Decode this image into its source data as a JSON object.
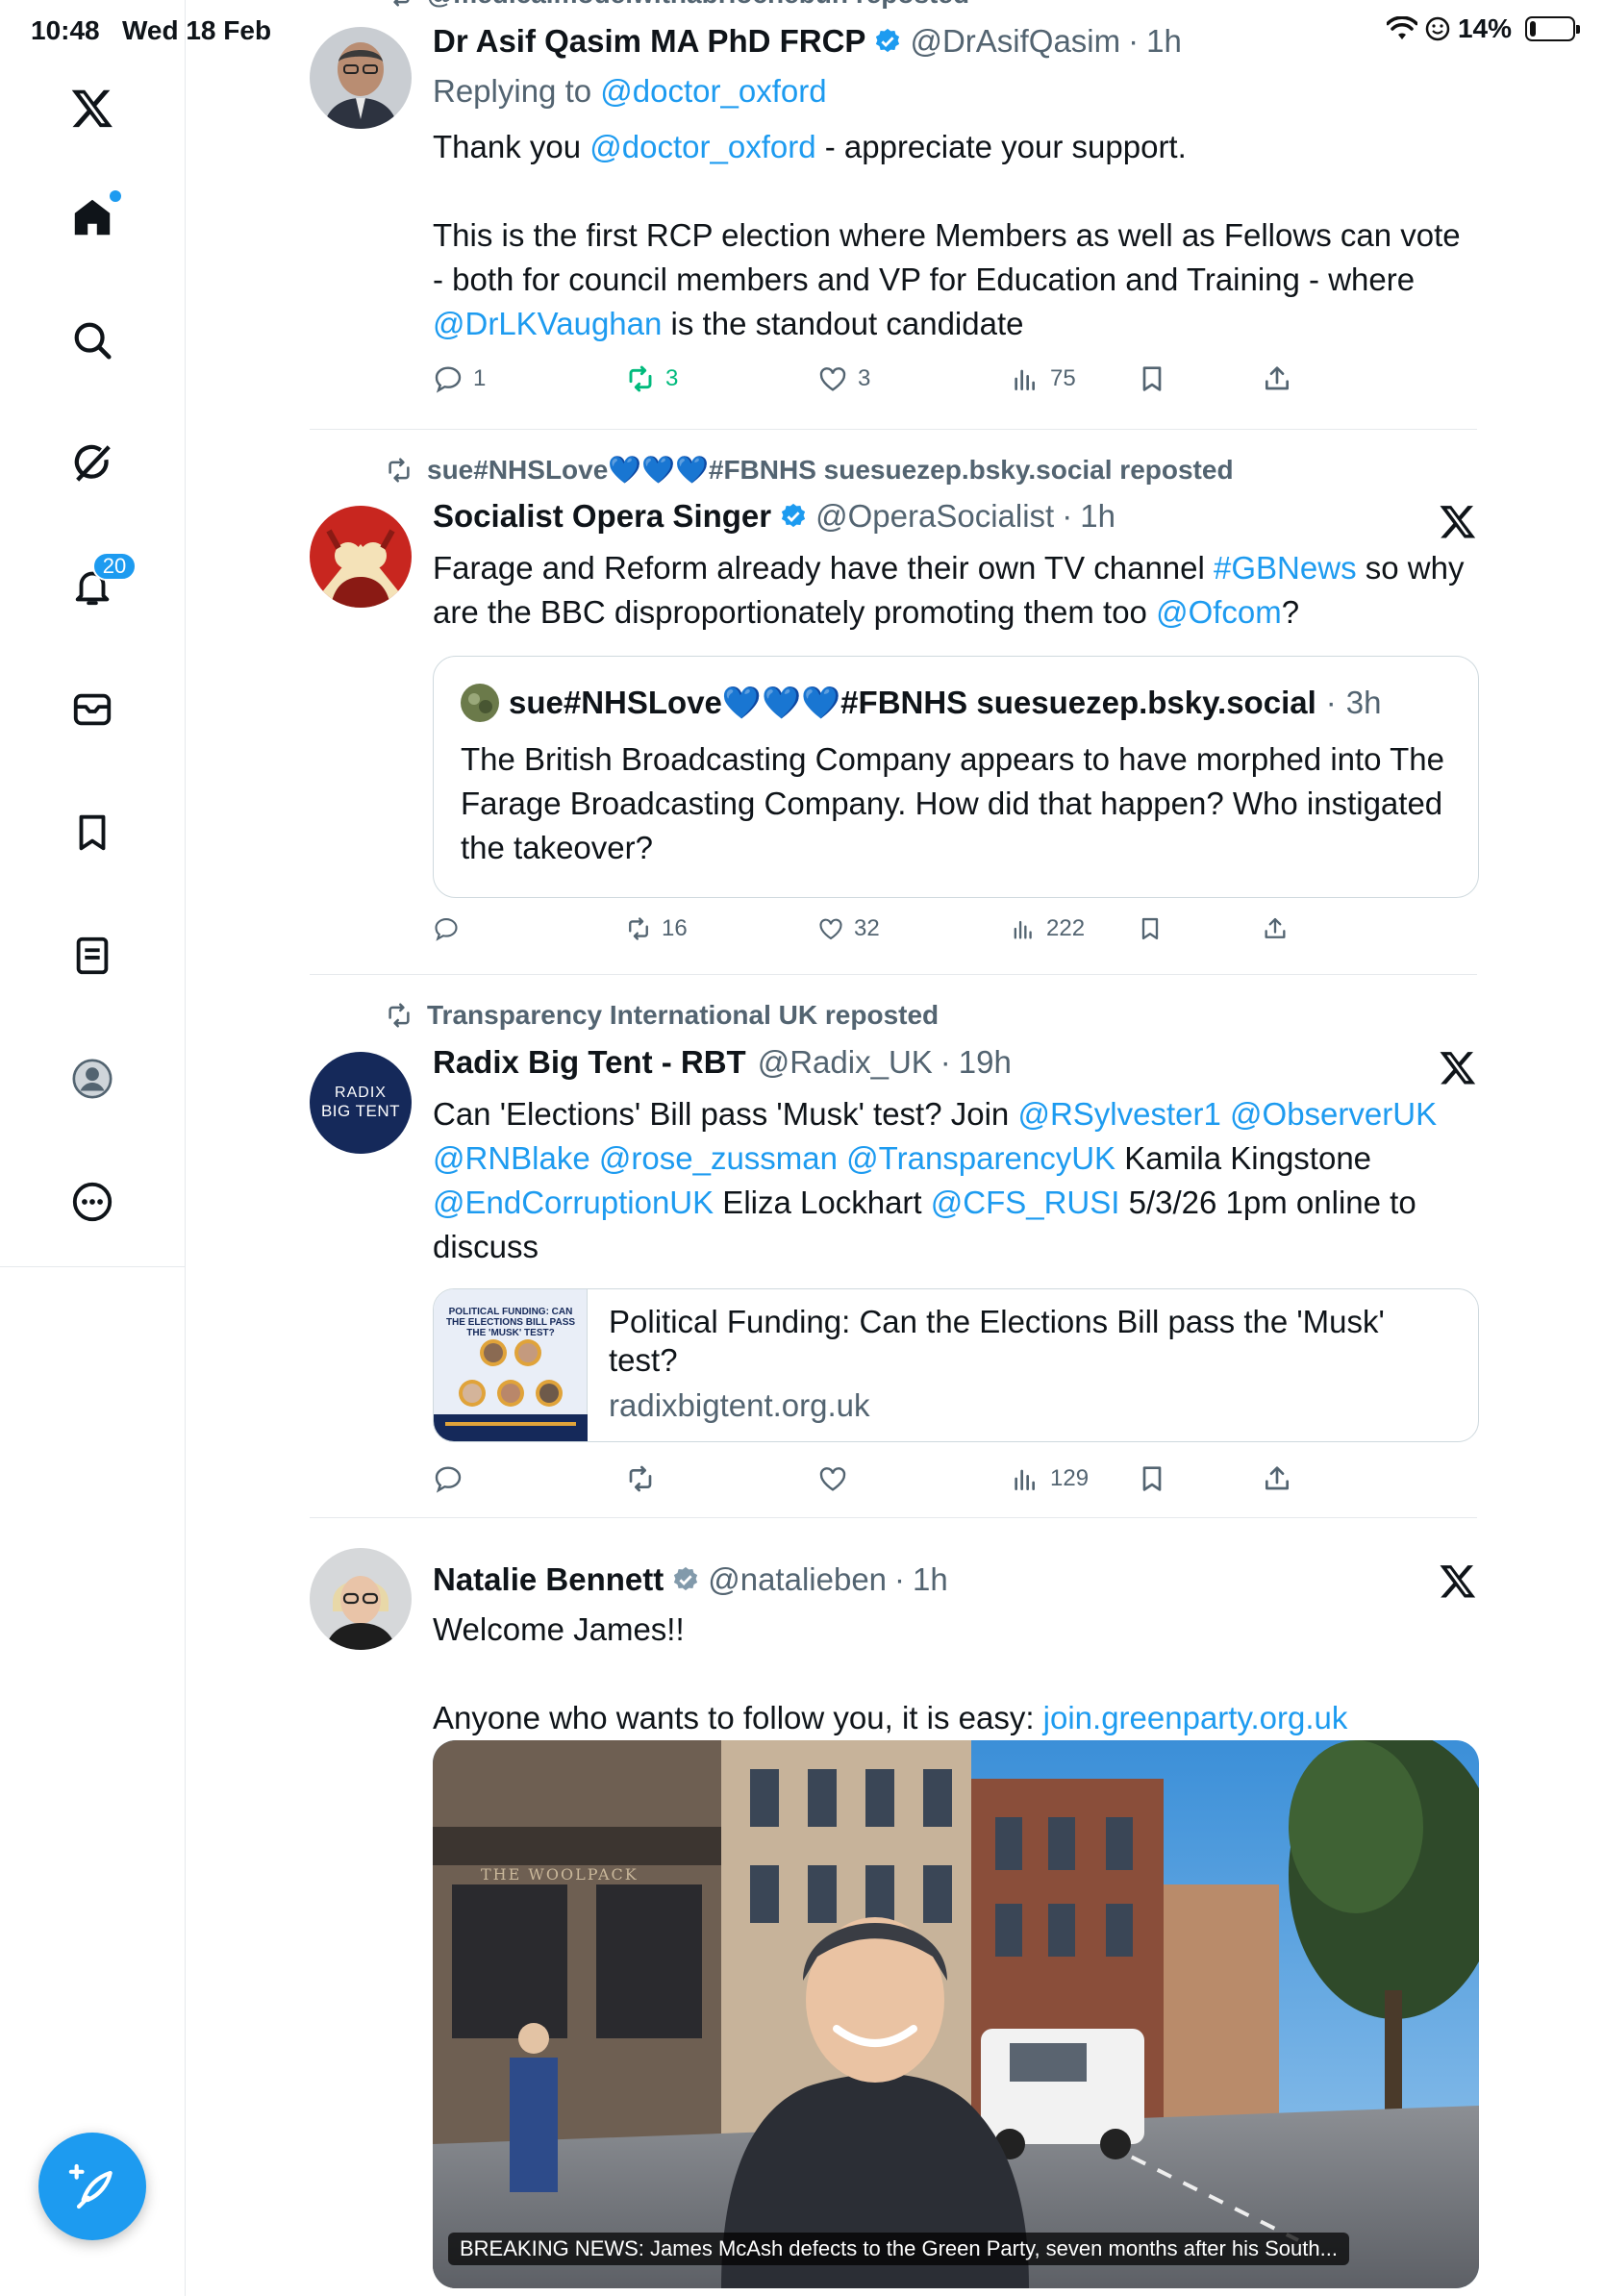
{
  "status_bar": {
    "time": "10:48",
    "date": "Wed 18 Feb",
    "battery": "14%",
    "battery_level": 0.14
  },
  "sidebar": {
    "items": [
      {
        "name": "x-logo-icon"
      },
      {
        "name": "home-icon"
      },
      {
        "name": "search-icon"
      },
      {
        "name": "grok-icon"
      },
      {
        "name": "notifications-icon",
        "badge": "20"
      },
      {
        "name": "messages-icon"
      },
      {
        "name": "bookmarks-icon"
      },
      {
        "name": "lists-icon"
      },
      {
        "name": "profile-icon"
      },
      {
        "name": "more-icon"
      }
    ],
    "compose": "compose-icon"
  },
  "posts": [
    {
      "repost_by": "@medicalmodelwithabriochebun reposted",
      "name": "Dr Asif Qasim MA PhD FRCP",
      "handle": "@DrAsifQasim",
      "time": "1h",
      "replying_label": "Replying to",
      "replying_to": "@doctor_oxford",
      "text": {
        "p1a": "Thank you ",
        "p1link": "@doctor_oxford",
        "p1b": "  - appreciate your support.",
        "p2a": "This is the first RCP election where Members as well as Fellows can vote - both for council members and VP for Education and Training - where ",
        "p2link": "@DrLKVaughan",
        "p2b": " is the standout candidate"
      },
      "replies": "1",
      "reposts": "3",
      "likes": "3",
      "views": "75"
    },
    {
      "repost_by": "sue#NHSLove💙💙💙#FBNHS suesuezep.bsky.social reposted",
      "name": "Socialist Opera Singer",
      "handle": "@OperaSocialist",
      "time": "1h",
      "text": {
        "a": "Farage and Reform already have their own TV channel ",
        "l1": "#GBNews",
        "b": " so why are the BBC disproportionately promoting them too ",
        "l2": "@Ofcom",
        "c": "?"
      },
      "quote": {
        "name": "sue#NHSLove💙💙💙#FBNHS suesuezep.bsky.social",
        "time": "3h",
        "text": "The British Broadcasting Company appears to have morphed into The Farage Broadcasting Company. How did that happen? Who instigated the takeover?"
      },
      "replies": "",
      "reposts": "16",
      "likes": "32",
      "views": "222"
    },
    {
      "repost_by": "Transparency International UK reposted",
      "name": "Radix Big Tent - RBT",
      "handle": "@Radix_UK",
      "time": "19h",
      "avatar_text_1": "RADIX",
      "avatar_text_2": "BIG TENT",
      "text": {
        "a": "Can 'Elections' Bill pass 'Musk' test? Join ",
        "l1": "@RSylvester1",
        "l2": "@ObserverUK",
        "l3": "@RNBlake",
        "l4": "@rose_zussman",
        "l5": "@TransparencyUK",
        "b": " Kamila Kingstone ",
        "l6": "@EndCorruptionUK",
        "c": " Eliza Lockhart ",
        "l7": "@CFS_RUSI",
        "d": " 5/3/26 1pm online to discuss"
      },
      "card": {
        "thumb_title": "POLITICAL FUNDING: CAN THE ELECTIONS BILL PASS THE 'MUSK' TEST?",
        "title": "Political Funding: Can the Elections Bill pass the 'Musk' test?",
        "domain": "radixbigtent.org.uk"
      },
      "replies": "",
      "reposts": "",
      "likes": "",
      "views": "129"
    },
    {
      "name": "Natalie Bennett",
      "handle": "@natalieben",
      "time": "1h",
      "text": {
        "p1": "Welcome James!!",
        "p2a": "Anyone who wants to follow you, it is easy: ",
        "p2link": "join.greenparty.org.uk"
      },
      "photo_sign": "THE WOOLPACK",
      "photo_caption": "BREAKING NEWS: James McAsh defects to the Green Party, seven months after his South..."
    }
  ],
  "colors": {
    "accent": "#1d9bf0",
    "muted": "#536471",
    "repost_green": "#00ba7c",
    "text": "#0f1419"
  }
}
